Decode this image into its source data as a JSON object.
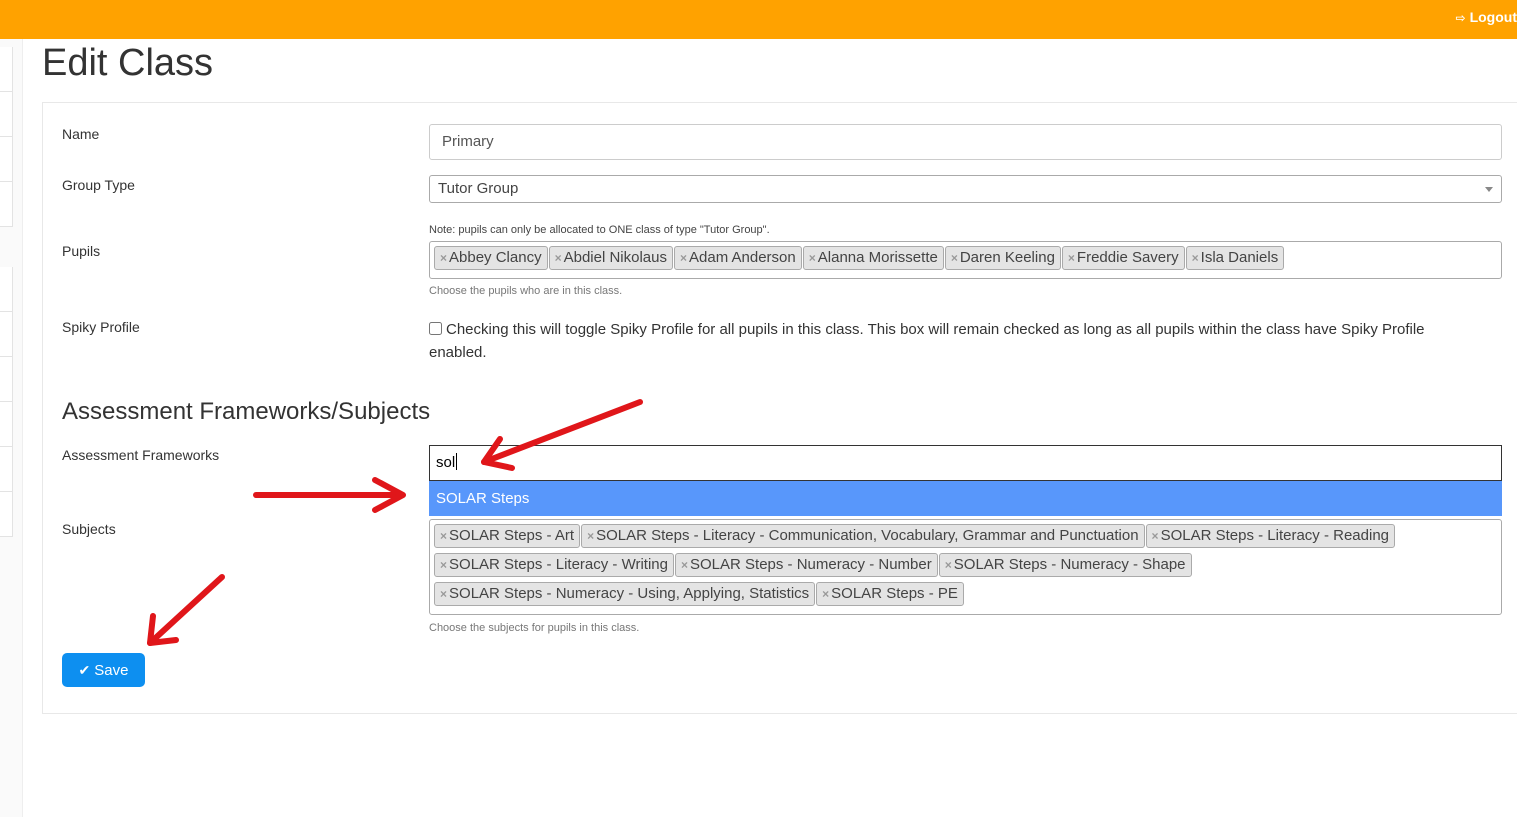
{
  "header": {
    "logout_label": "Logout",
    "logout_icon": "sign-out-icon",
    "bar_color": "#ffa200"
  },
  "page": {
    "title": "Edit Class"
  },
  "form": {
    "name": {
      "label": "Name",
      "value": "Primary"
    },
    "group_type": {
      "label": "Group Type",
      "value": "Tutor Group"
    },
    "pupils": {
      "label": "Pupils",
      "note": "Note: pupils can only be allocated to ONE class of type \"Tutor Group\".",
      "tags": [
        "Abbey Clancy",
        "Abdiel Nikolaus",
        "Adam Anderson",
        "Alanna Morissette",
        "Daren Keeling",
        "Freddie Savery",
        "Isla Daniels"
      ],
      "help": "Choose the pupils who are in this class."
    },
    "spiky_profile": {
      "label": "Spiky Profile",
      "checked": false,
      "text": "Checking this will toggle Spiky Profile for all pupils in this class. This box will remain checked as long as all pupils within the class have Spiky Profile enabled."
    },
    "section_title": "Assessment Frameworks/Subjects",
    "assessment_frameworks": {
      "label": "Assessment Frameworks",
      "search_value": "sol",
      "dropdown_option": "SOLAR Steps"
    },
    "subjects": {
      "label": "Subjects",
      "tags": [
        "SOLAR Steps - Art",
        "SOLAR Steps - Literacy - Communication, Vocabulary, Grammar and Punctuation",
        "SOLAR Steps - Literacy - Reading",
        "SOLAR Steps - Literacy - Writing",
        "SOLAR Steps - Numeracy - Number",
        "SOLAR Steps - Numeracy - Shape",
        "SOLAR Steps - Numeracy - Using, Applying, Statistics",
        "SOLAR Steps - PE"
      ],
      "help": "Choose the subjects for pupils in this class."
    },
    "save_label": "Save"
  },
  "annotations": {
    "arrow_color": "#e0161a"
  }
}
